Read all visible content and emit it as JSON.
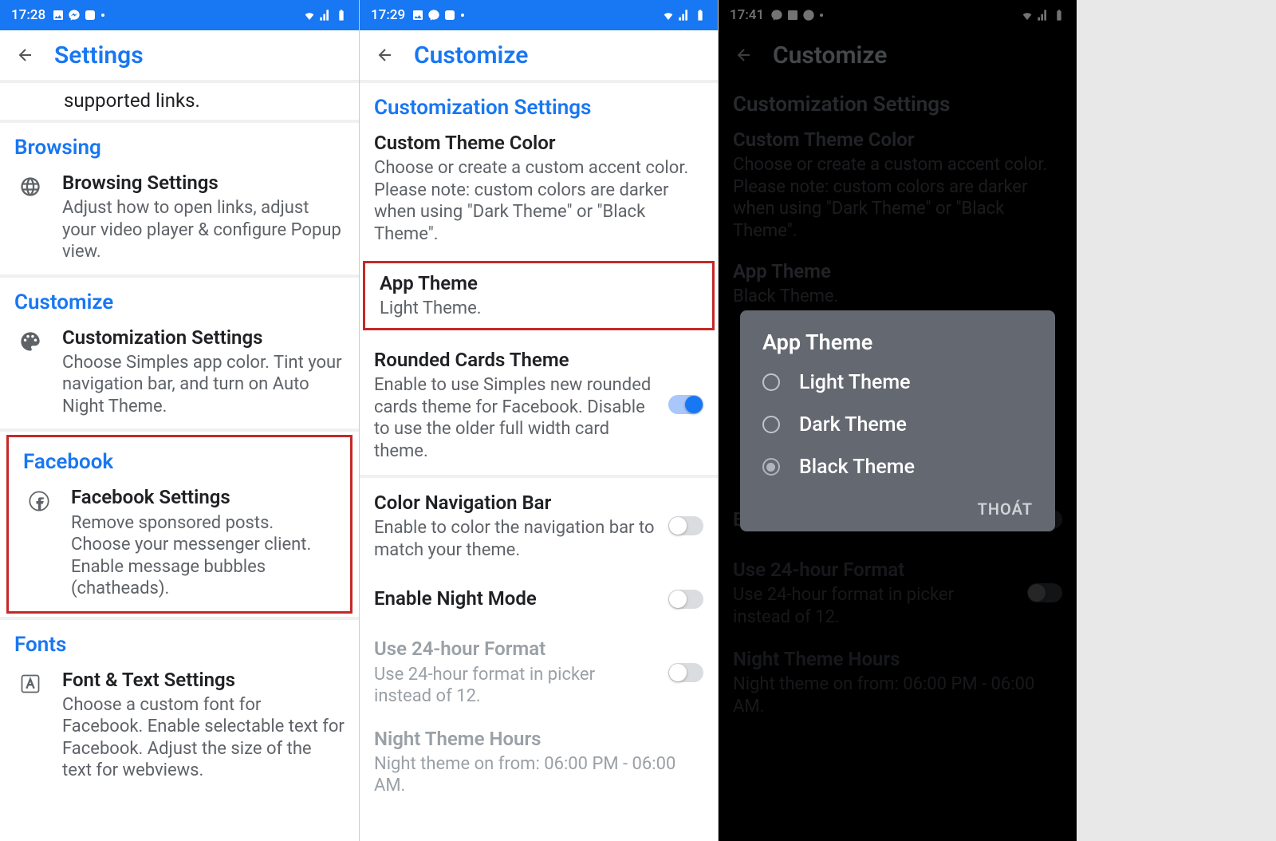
{
  "screen1": {
    "status": {
      "time": "17:28"
    },
    "title": "Settings",
    "partial_top": "supported links.",
    "sections": {
      "browsing": {
        "header": "Browsing",
        "item_title": "Browsing Settings",
        "item_desc": "Adjust how to open links, adjust your video player & configure Popup view."
      },
      "customize": {
        "header": "Customize",
        "item_title": "Customization Settings",
        "item_desc": "Choose Simples app color. Tint your navigation bar, and turn on Auto Night Theme."
      },
      "facebook": {
        "header": "Facebook",
        "item_title": "Facebook Settings",
        "item_desc": "Remove sponsored posts. Choose your messenger client. Enable message bubbles (chatheads)."
      },
      "fonts": {
        "header": "Fonts",
        "item_title": "Font & Text Settings",
        "item_desc": "Choose a custom font for Facebook. Enable selectable text for Facebook. Adjust the size of the text for webviews."
      }
    }
  },
  "screen2": {
    "status": {
      "time": "17:29"
    },
    "title": "Customize",
    "section_header": "Customization Settings",
    "items": {
      "custom_color": {
        "title": "Custom Theme Color",
        "desc": "Choose or create a custom accent color. Please note: custom colors are darker when using \"Dark Theme\" or \"Black Theme\"."
      },
      "app_theme": {
        "title": "App Theme",
        "desc": "Light Theme."
      },
      "rounded": {
        "title": "Rounded Cards Theme",
        "desc": "Enable to use Simples new rounded cards theme for Facebook. Disable to use the older full width card theme."
      },
      "nav_bar": {
        "title": "Color Navigation Bar",
        "desc": "Enable to color the navigation bar to match your theme."
      },
      "night_mode": {
        "title": "Enable Night Mode"
      },
      "format24": {
        "title": "Use 24-hour Format",
        "desc": "Use 24-hour format in picker instead of 12."
      },
      "night_hours": {
        "title": "Night Theme Hours",
        "desc": "Night theme on from: 06:00 PM - 06:00 AM."
      }
    }
  },
  "screen3": {
    "status": {
      "time": "17:41"
    },
    "title": "Customize",
    "section_header": "Customization Settings",
    "items": {
      "custom_color": {
        "title": "Custom Theme Color",
        "desc": "Choose or create a custom accent color. Please note: custom colors are darker when using \"Dark Theme\" or \"Black Theme\"."
      },
      "app_theme": {
        "title": "App Theme",
        "desc": "Black Theme."
      },
      "night_mode": {
        "title": "Enable Night Mode"
      },
      "format24": {
        "title": "Use 24-hour Format",
        "desc": "Use 24-hour format in picker instead of 12."
      },
      "night_hours": {
        "title": "Night Theme Hours",
        "desc": "Night theme on from: 06:00 PM - 06:00 AM."
      }
    },
    "dialog": {
      "title": "App Theme",
      "options": [
        "Light Theme",
        "Dark Theme",
        "Black Theme"
      ],
      "selected": "Black Theme",
      "action": "THOÁT"
    }
  }
}
